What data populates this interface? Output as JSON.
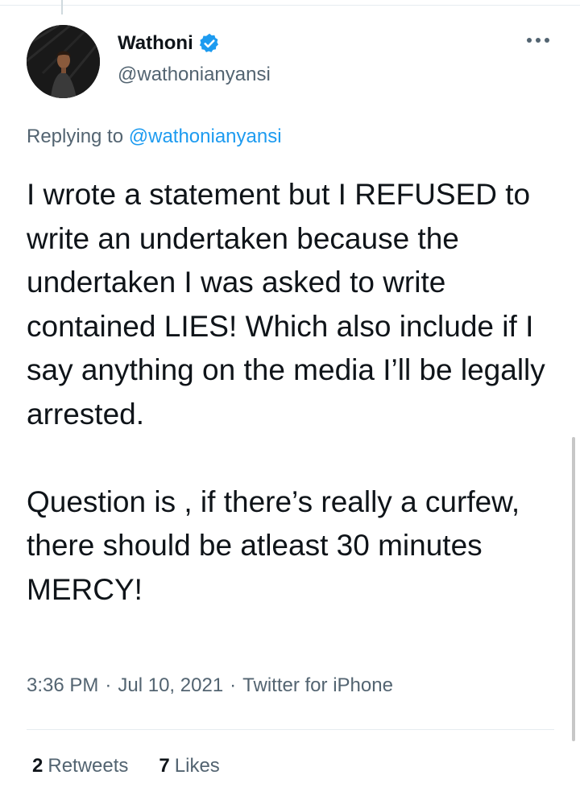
{
  "author": {
    "display_name": "Wathoni",
    "handle": "@wathonianyansi",
    "verified": true,
    "avatar_icon": "profile-photo"
  },
  "reply": {
    "prefix": "Replying to ",
    "mention": "@wathonianyansi"
  },
  "tweet": {
    "paragraphs": [
      "I wrote a statement but I REFUSED to write an undertaken because the undertaken I was asked to write contained LIES! Which also include if I say anything on the media I’ll be legally arrested.",
      "Question is , if there’s really a curfew, there should be atleast 30 minutes MERCY!"
    ]
  },
  "meta": {
    "time": "3:36 PM",
    "date": "Jul 10, 2021",
    "source": "Twitter for iPhone",
    "separator": "·"
  },
  "stats": {
    "retweets_count": "2",
    "retweets_label": "Retweets",
    "likes_count": "7",
    "likes_label": "Likes"
  },
  "colors": {
    "link": "#1d9bf0",
    "secondary_text": "#536471",
    "primary_text": "#0f1419",
    "verified_badge": "#1d9bf0"
  }
}
